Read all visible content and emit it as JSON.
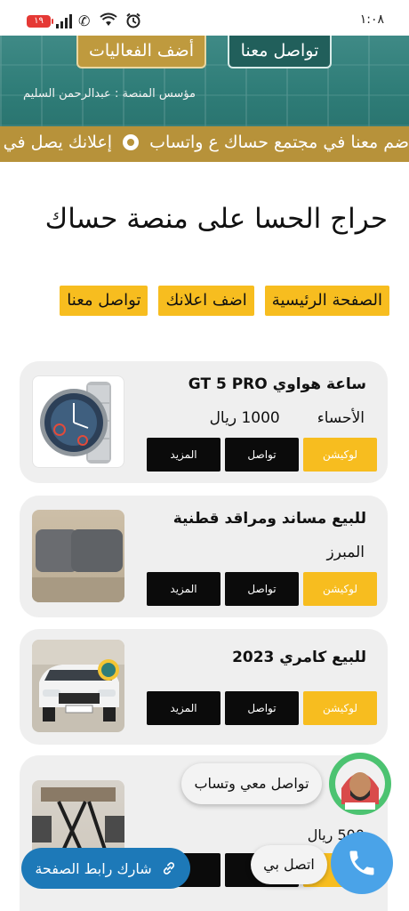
{
  "status_bar": {
    "time": "١:٠٨",
    "battery": "١٩",
    "icons": [
      "signal-icon",
      "phone-wifi-call-icon",
      "wifi-icon",
      "alarm-icon"
    ]
  },
  "hero": {
    "events_button": "أضف الفعاليات",
    "contact_button": "تواصل معنا",
    "founder": "مؤسس المنصة : عبدالرحمن السليم"
  },
  "ticker": {
    "text_1": "إعلانك يصل في كل",
    "text_2": "ضم معنا في مجتمع حساك ع واتساب"
  },
  "page": {
    "title": "حراج الحسا على منصة حساك"
  },
  "nav": {
    "home": "الصفحة الرئيسية",
    "add_ad": "اضف اعلانك",
    "contact": "تواصل معنا"
  },
  "listings": [
    {
      "title": "ساعة هواوي GT 5 PRO",
      "location": "الأحساء",
      "price": "1000 ريال",
      "btn_location": "لوكيشن",
      "btn_contact": "تواصل",
      "btn_more": "المزيد"
    },
    {
      "title": "للبيع مساند ومراقد قطنية",
      "location": "المبرز",
      "price": "",
      "btn_location": "لوكيشن",
      "btn_contact": "تواصل",
      "btn_more": "المزيد"
    },
    {
      "title": "للبيع كامري 2023",
      "location": "",
      "price": "",
      "btn_location": "لوكيشن",
      "btn_contact": "تواصل",
      "btn_more": "المزيد"
    },
    {
      "title": "...",
      "location": "",
      "price": "500 ريال",
      "btn_location": "",
      "btn_contact": "",
      "btn_more": ""
    }
  ],
  "floating": {
    "whatsapp_label": "تواصل معي وتساب",
    "call_label": "اتصل بي",
    "share_label": "شارك رابط الصفحة"
  },
  "colors": {
    "teal": "#2f7d78",
    "gold": "#b7923a",
    "yellow": "#f7bd1f",
    "black": "#0b0b0b",
    "blue": "#1d79b8"
  }
}
